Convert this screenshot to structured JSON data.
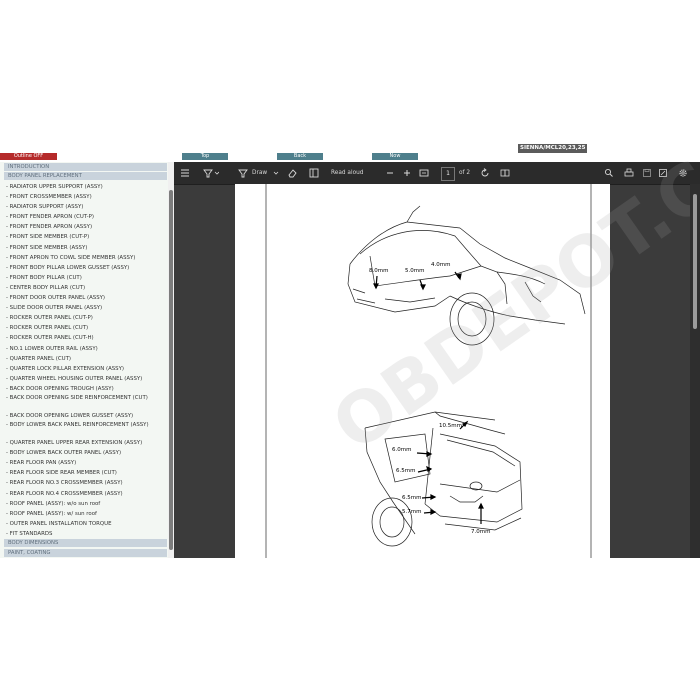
{
  "header": {
    "outline_btn": "Outline OFF",
    "top_btn": "Top",
    "back_btn": "Back",
    "next_btn": "Now",
    "model": "SIENNA/MCL20,23,25"
  },
  "sidebar": {
    "sections": [
      "INTRODUCTION",
      "BODY PANEL REPLACEMENT",
      "BODY DIMENSIONS",
      "PAINT, COATING"
    ],
    "items": [
      "- RADIATOR UPPER SUPPORT (ASSY)",
      "- FRONT CROSSMEMBER (ASSY)",
      "- RADIATOR SUPPORT (ASSY)",
      "- FRONT FENDER APRON (CUT-P)",
      "- FRONT FENDER APRON (ASSY)",
      "- FRONT SIDE MEMBER (CUT-P)",
      "- FRONT SIDE MEMBER (ASSY)",
      "- FRONT APRON TO COWL SIDE MEMBER (ASSY)",
      "- FRONT BODY PILLAR LOWER GUSSET (ASSY)",
      "- FRONT BODY PILLAR (CUT)",
      "- CENTER BODY PILLAR (CUT)",
      "- FRONT DOOR OUTER PANEL (ASSY)",
      "- SLIDE DOOR OUTER PANEL (ASSY)",
      "- ROCKER OUTER PANEL (CUT-P)",
      "- ROCKER OUTER PANEL (CUT)",
      "- ROCKER OUTER PANEL (CUT-H)",
      "- NO.1 LOWER OUTER RAIL (ASSY)",
      "- QUARTER PANEL (CUT)",
      "- QUARTER LOCK PILLAR EXTENSION (ASSY)",
      "- QUARTER WHEEL HOUSING OUTER PANEL (ASSY)",
      "- BACK DOOR OPENING TROUGH (ASSY)",
      "- BACK DOOR OPENING SIDE REINFORCEMENT (CUT)",
      "- BACK DOOR OPENING LOWER GUSSET (ASSY)",
      "- BODY LOWER BACK PANEL REINFORCEMENT (ASSY)",
      "- QUARTER PANEL UPPER REAR EXTENSION (ASSY)",
      "- BODY LOWER BACK OUTER PANEL (ASSY)",
      "- REAR FLOOR PAN (ASSY)",
      "- REAR FLOOR SIDE REAR MEMBER (CUT)",
      "- REAR FLOOR NO.3 CROSSMEMBER (ASSY)",
      "- REAR FLOOR NO.4 CROSSMEMBER (ASSY)",
      "- ROOF PANEL (ASSY): w/o sun roof",
      "- ROOF PANEL (ASSY): w/ sun roof",
      "- OUTER PANEL INSTALLATION TORQUE",
      "- FIT STANDARDS"
    ]
  },
  "toolbar": {
    "draw_label": "Draw",
    "read_aloud_label": "Read aloud",
    "page_current": "1",
    "page_total": "of 2",
    "icons": [
      "list-icon",
      "filter-icon",
      "draw-icon",
      "eraser-icon",
      "panel-icon",
      "zoom-out-icon",
      "zoom-in-icon",
      "fit-page-icon",
      "rotate-icon",
      "two-page-icon",
      "search-icon",
      "print-icon",
      "save-icon",
      "save-as-icon",
      "settings-icon"
    ]
  },
  "document": {
    "watermark": "OBDEPOT.COM",
    "front_labels": [
      "8.0mm",
      "5.0mm",
      "4.0mm"
    ],
    "rear_labels": [
      "10.5mm",
      "6.0mm",
      "6.5mm",
      "6.5mm",
      "5.7mm",
      "7.0mm"
    ]
  }
}
